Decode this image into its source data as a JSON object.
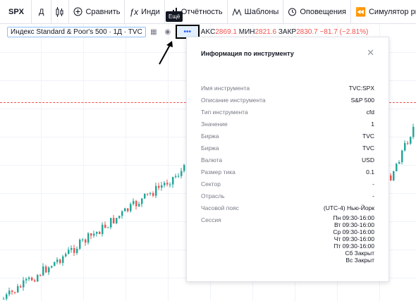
{
  "toolbar": {
    "symbol": "SPX",
    "interval": "Д",
    "compare": "Сравнить",
    "indicators": "Инди",
    "financials": "Отчётность",
    "templates": "Шаблоны",
    "alerts": "Оповещения",
    "replay": "Симулятор рынка"
  },
  "legend": {
    "title": "Индекс Standard & Poor's 500 · 1Д · TVC",
    "more": "•••",
    "high_label": "AKC",
    "high": "2869.1",
    "low_label": "МИН",
    "low": "2821.6",
    "close_label": "ЗАКР",
    "close": "2830.7",
    "change": "−81.7 (−2.81%)"
  },
  "tooltip": "Ещё",
  "panel": {
    "title": "Информация по инструменту",
    "rows": [
      {
        "label": "Имя инструмента",
        "value": "TVC:SPX"
      },
      {
        "label": "Описание инструмента",
        "value": "S&P 500"
      },
      {
        "label": "Тип инструмента",
        "value": "cfd"
      },
      {
        "label": "Значение",
        "value": "1"
      },
      {
        "label": "Биржа",
        "value": "TVC"
      },
      {
        "label": "Биржа",
        "value": "TVC"
      },
      {
        "label": "Валюта",
        "value": "USD"
      },
      {
        "label": "Размер тика",
        "value": "0.1"
      },
      {
        "label": "Сектор",
        "value": "-"
      },
      {
        "label": "Отрасль",
        "value": "-"
      },
      {
        "label": "Часовой пояс",
        "value": "(UTC-4) Нью-Йорк"
      }
    ],
    "session_label": "Сессия",
    "session": [
      "Пн 09:30-16:00",
      "Вт 09:30-16:00",
      "Ср 09:30-16:00",
      "Чт 09:30-16:00",
      "Пт 09:30-16:00",
      "Сб Закрыт",
      "Вс Закрыт"
    ]
  },
  "colors": {
    "up": "#26a69a",
    "down": "#ef5350",
    "accent": "#2962ff"
  }
}
